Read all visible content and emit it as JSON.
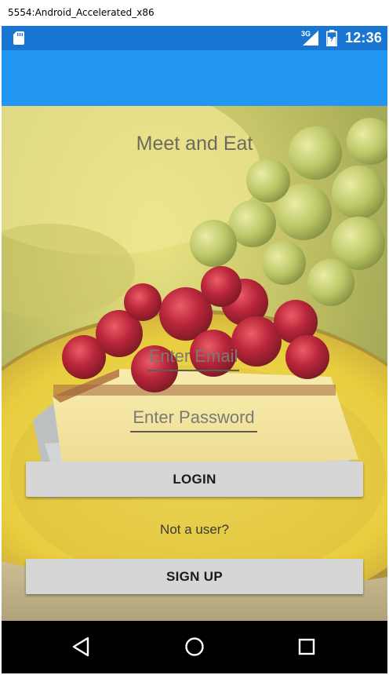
{
  "window": {
    "title": "5554:Android_Accelerated_x86"
  },
  "status_bar": {
    "network": "3G",
    "time": "12:36",
    "icons": [
      "sd-card-icon",
      "signal-icon",
      "battery-icon"
    ]
  },
  "app": {
    "title": "Meet and Eat"
  },
  "login_form": {
    "email_placeholder": "Enter Email",
    "email_value": "",
    "password_placeholder": "Enter Password",
    "password_value": "",
    "login_label": "LOGIN",
    "not_user_text": "Not a user?",
    "signup_label": "SIGN UP"
  },
  "nav_bar": {
    "icons": [
      "back-icon",
      "home-icon",
      "recent-apps-icon"
    ]
  },
  "colors": {
    "status_bar": "#1976d2",
    "app_bar": "#2196f3",
    "button": "#d6d6d6",
    "nav_bar": "#000000"
  }
}
